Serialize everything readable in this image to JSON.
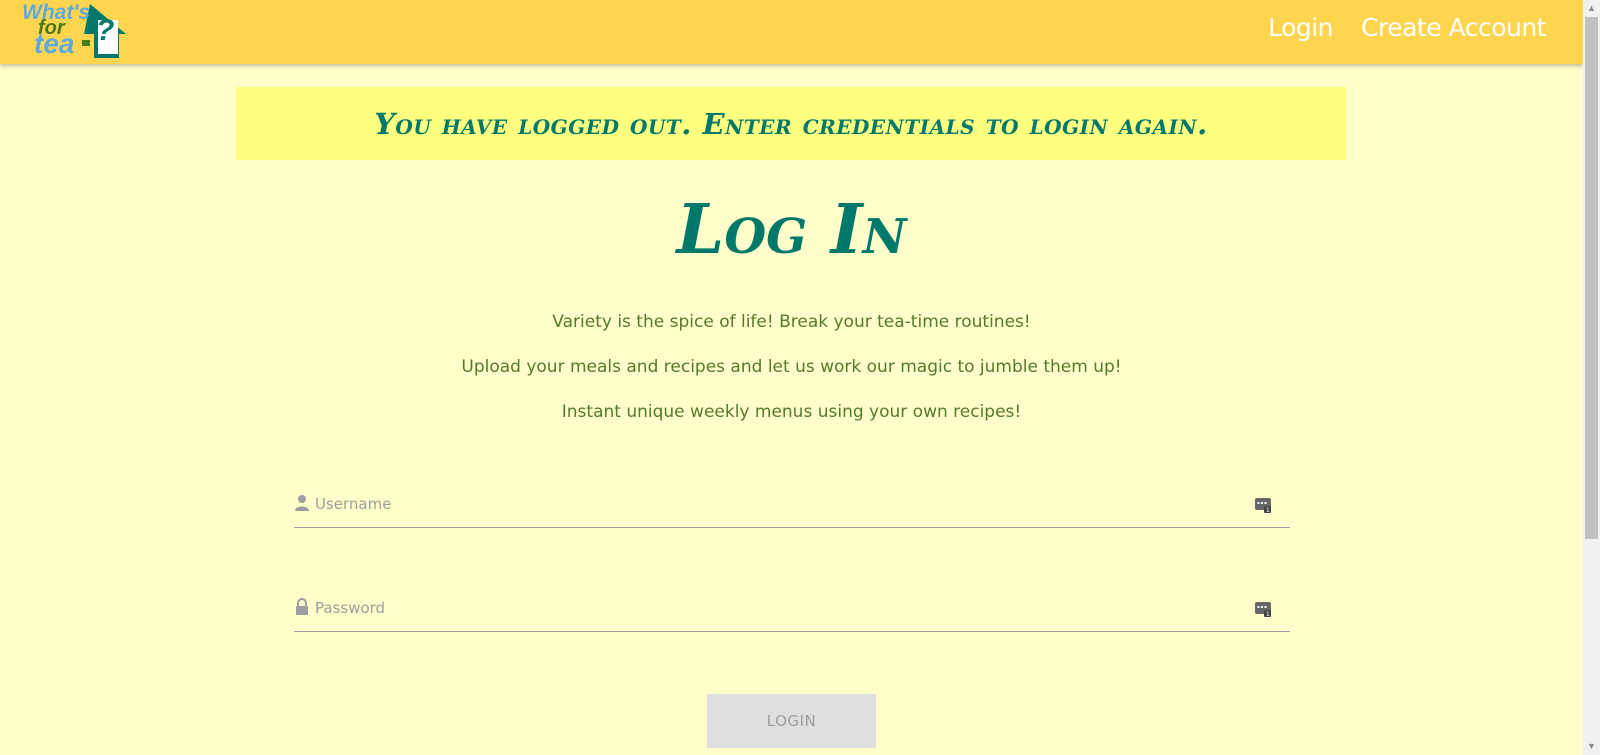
{
  "logo": {
    "line1": "What's",
    "line2": "for",
    "line3": "tea",
    "mark": "?"
  },
  "nav": {
    "login": "Login",
    "create_account": "Create Account"
  },
  "alert": {
    "text": "You have logged out. Enter credentials to login again."
  },
  "page": {
    "title": "Log In",
    "taglines": [
      "Variety is the spice of life! Break your tea-time routines!",
      "Upload your meals and recipes and let us work our magic to jumble them up!",
      "Instant unique weekly menus using your own recipes!"
    ]
  },
  "form": {
    "username_placeholder": "Username",
    "password_placeholder": "Password",
    "submit_label": "LOGIN"
  },
  "icons": {
    "username": "user-icon",
    "password": "lock-icon",
    "password_manager": "password-manager-icon"
  },
  "colors": {
    "navbar": "#ffd54f",
    "page_background": "#ffffcc",
    "alert_background": "#ffff80",
    "heading": "#00796b",
    "tagline": "#557a28",
    "button": "#dfdfdf"
  }
}
